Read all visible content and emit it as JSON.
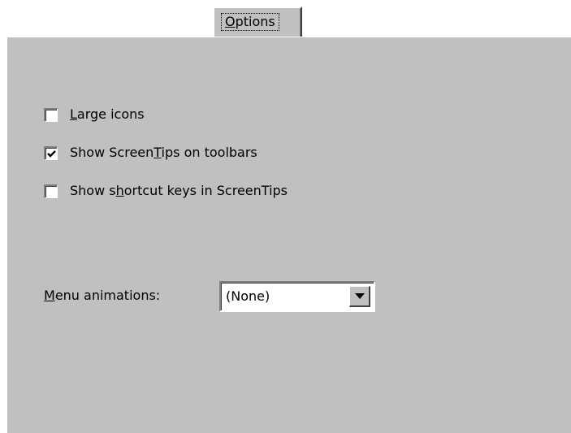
{
  "tab": {
    "label_underlined": "O",
    "label_rest": "ptions"
  },
  "options": {
    "large_icons": {
      "checked": false,
      "pre": "",
      "accel": "L",
      "post": "arge icons"
    },
    "show_screentips": {
      "checked": true,
      "pre": "Show Screen",
      "accel": "T",
      "post": "ips on toolbars"
    },
    "show_shortcut_keys": {
      "checked": false,
      "pre": "Show s",
      "accel": "h",
      "post": "ortcut keys in ScreenTips"
    }
  },
  "menu_animations": {
    "label_accel": "M",
    "label_rest": "enu animations:",
    "value": "(None)"
  },
  "icons": {
    "checkmark": "checkmark-icon",
    "dropdown": "dropdown-arrow-icon"
  }
}
